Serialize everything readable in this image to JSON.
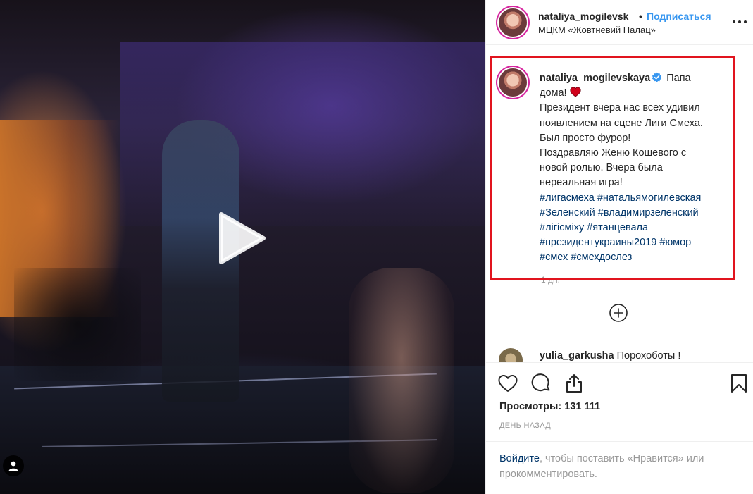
{
  "header": {
    "username": "nataliya_mogilevsk",
    "dot": "•",
    "follow_label": "Подписаться",
    "location": "МЦКМ «Жовтневий Палац»"
  },
  "caption": {
    "username": "nataliya_mogilevskaya",
    "line1": "Папа",
    "line2_start": "дома!",
    "body_lines": [
      "Президент вчера нас всех удивил",
      "появлением на сцене Лиги Смеха.",
      "Был просто фурор!",
      "Поздравляю Женю Кошевого с",
      "новой ролью. Вчера была",
      "нереальная игра!"
    ],
    "hashtags": [
      "#лигасмеха",
      "#натальямогилевская",
      "#Зеленский",
      "#владимирзеленский",
      "#лігісміху",
      "#ятанцевала",
      "#президентукраины2019",
      "#юмор",
      "#смех",
      "#смехдослез"
    ],
    "time_ago": "1 дн."
  },
  "comment2": {
    "username": "yulia_garkusha",
    "text": "Порохоботы !"
  },
  "stats": {
    "views_label": "Просмотры:",
    "views_count": "131 111",
    "date": "ДЕНЬ НАЗАД"
  },
  "login": {
    "link": "Войдите",
    "text": ", чтобы поставить «Нравится» или прокомментировать."
  },
  "colors": {
    "link_blue": "#3897f0",
    "hashtag_navy": "#003569",
    "highlight_red": "#e1141e",
    "verified_blue": "#3897f0",
    "heart_red": "#d0021b"
  },
  "icons": [
    "play-icon",
    "user-tag-icon",
    "more-icon",
    "verified-icon",
    "heart-icon",
    "add-circle-icon",
    "like-icon",
    "comment-icon",
    "share-icon",
    "bookmark-icon"
  ]
}
